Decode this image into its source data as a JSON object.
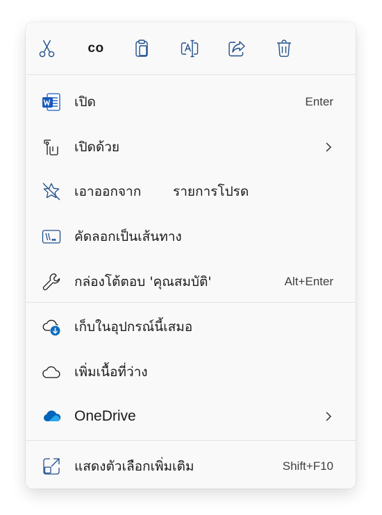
{
  "toolbar": {
    "cut_icon": "scissors-icon",
    "copy_label": "co",
    "paste_icon": "clipboard-icon",
    "rename_icon": "rename-icon",
    "share_icon": "share-icon",
    "delete_icon": "trash-icon"
  },
  "items": [
    {
      "label": "เปิด",
      "shortcut": "Enter",
      "icon": "word-document-icon"
    },
    {
      "label": "เปิดด้วย",
      "icon": "open-with-icon",
      "has_submenu": true
    },
    {
      "label": "เอาออกจาก",
      "label_part2": "รายการโปรด",
      "icon": "star-off-icon"
    },
    {
      "label": "คัดลอกเป็นเส้นทาง",
      "icon": "copy-path-icon"
    },
    {
      "label": "กล่องโต้ตอบ 'คุณสมบัติ'",
      "shortcut": "Alt+Enter",
      "icon": "wrench-icon"
    },
    {
      "label": "เก็บในอุปกรณ์นี้เสมอ",
      "icon": "cloud-download-icon"
    },
    {
      "label": "เพิ่มเนื้อที่ว่าง",
      "icon": "cloud-icon"
    },
    {
      "label": "OneDrive",
      "icon": "onedrive-icon",
      "has_submenu": true
    },
    {
      "label": "แสดงตัวเลือกเพิ่มเติม",
      "shortcut": "Shift+F10",
      "icon": "more-options-icon"
    }
  ],
  "colors": {
    "menu_background": "#f9f9f9",
    "accent_blue": "#0f6cbd",
    "word_blue": "#185abd",
    "onedrive_blue": "#0364b8",
    "icon_stroke": "#1f4e8c"
  }
}
